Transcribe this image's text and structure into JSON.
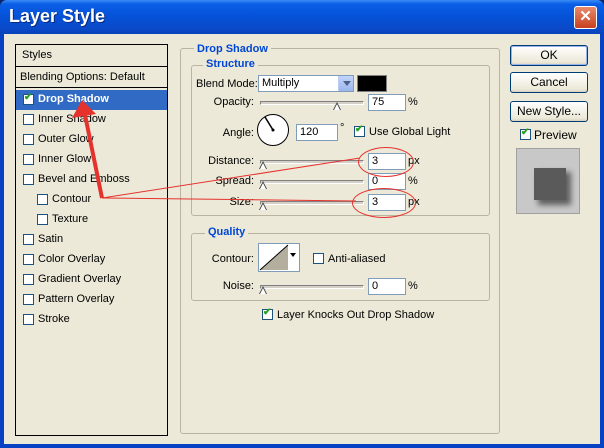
{
  "window": {
    "title": "Layer Style",
    "close_glyph": "✕"
  },
  "styles_panel": {
    "header": "Styles",
    "blending": "Blending Options: Default",
    "items": [
      {
        "label": "Drop Shadow",
        "checked": true,
        "selected": true,
        "indent": false
      },
      {
        "label": "Inner Shadow",
        "checked": false,
        "selected": false,
        "indent": false
      },
      {
        "label": "Outer Glow",
        "checked": false,
        "selected": false,
        "indent": false
      },
      {
        "label": "Inner Glow",
        "checked": false,
        "selected": false,
        "indent": false
      },
      {
        "label": "Bevel and Emboss",
        "checked": false,
        "selected": false,
        "indent": false
      },
      {
        "label": "Contour",
        "checked": false,
        "selected": false,
        "indent": true
      },
      {
        "label": "Texture",
        "checked": false,
        "selected": false,
        "indent": true
      },
      {
        "label": "Satin",
        "checked": false,
        "selected": false,
        "indent": false
      },
      {
        "label": "Color Overlay",
        "checked": false,
        "selected": false,
        "indent": false
      },
      {
        "label": "Gradient Overlay",
        "checked": false,
        "selected": false,
        "indent": false
      },
      {
        "label": "Pattern Overlay",
        "checked": false,
        "selected": false,
        "indent": false
      },
      {
        "label": "Stroke",
        "checked": false,
        "selected": false,
        "indent": false
      }
    ]
  },
  "drop_shadow": {
    "title": "Drop Shadow",
    "structure": {
      "title": "Structure",
      "blend_mode_label": "Blend Mode:",
      "blend_mode_value": "Multiply",
      "shadow_color": "#000000",
      "opacity_label": "Opacity:",
      "opacity_value": "75",
      "opacity_unit": "%",
      "opacity_level": 0.75,
      "angle_label": "Angle:",
      "angle_value": "120",
      "angle_unit": "°",
      "use_global_light_label": "Use Global Light",
      "use_global_light": true,
      "distance_label": "Distance:",
      "distance_value": "3",
      "distance_unit": "px",
      "spread_label": "Spread:",
      "spread_value": "0",
      "spread_unit": "%",
      "size_label": "Size:",
      "size_value": "3",
      "size_unit": "px"
    },
    "quality": {
      "title": "Quality",
      "contour_label": "Contour:",
      "anti_aliased_label": "Anti-aliased",
      "anti_aliased": false,
      "noise_label": "Noise:",
      "noise_value": "0",
      "noise_unit": "%"
    },
    "knockout_label": "Layer Knocks Out Drop Shadow",
    "knockout": true
  },
  "buttons": {
    "ok": "OK",
    "cancel": "Cancel",
    "new_style": "New Style...",
    "preview_label": "Preview",
    "preview": true
  },
  "annotation_color": "#e6322d"
}
